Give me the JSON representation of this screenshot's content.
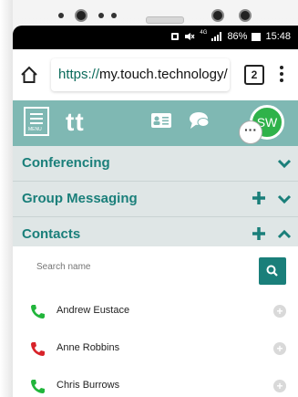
{
  "statusbar": {
    "battery": "86%",
    "time": "15:48",
    "signal": "4G"
  },
  "browser": {
    "url_scheme": "https://",
    "url_host": "my.touch.technology/",
    "tab_count": "2"
  },
  "app": {
    "logo": "tt",
    "menu_label": "MENU",
    "avatar_initials": "SW",
    "badge": "···"
  },
  "sections": {
    "conferencing": "Conferencing",
    "group_messaging": "Group Messaging",
    "contacts": "Contacts"
  },
  "search": {
    "placeholder": "Search name"
  },
  "contacts": [
    {
      "name": "Andrew Eustace",
      "status_color": "#21b53b"
    },
    {
      "name": "Anne Robbins",
      "status_color": "#d8232a"
    },
    {
      "name": "Chris Burrows",
      "status_color": "#21b53b"
    }
  ],
  "colors": {
    "accent": "#1a7f7a",
    "header": "#7fb8b3",
    "section_bg": "#dfe6e6"
  }
}
